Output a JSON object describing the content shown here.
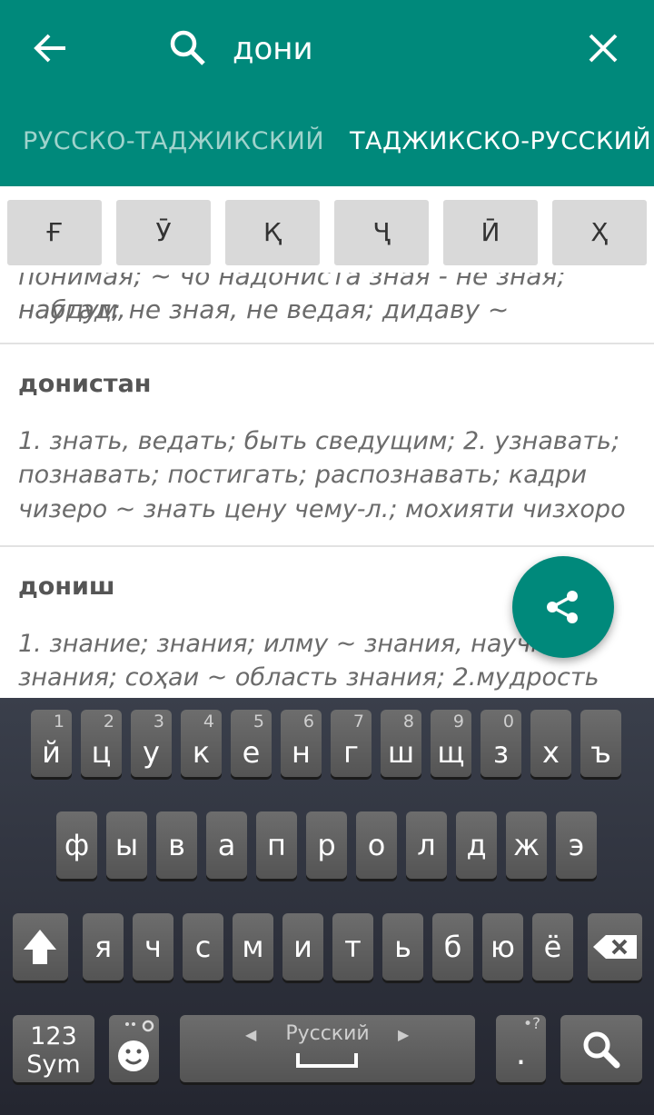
{
  "search": {
    "query": "дони"
  },
  "tabs": [
    {
      "label": "РУССКО-ТАДЖИКСКИЙ"
    },
    {
      "label": "ТАДЖИКСКО-РУССКИЙ"
    }
  ],
  "special_chars": [
    "Ғ",
    "Ӯ",
    "Қ",
    "Ҷ",
    "Ӣ",
    "Ҳ"
  ],
  "entries": {
    "partial_line_1": "понимая; ~ чо надониста зная - не зная; набдум,",
    "partial_line_2": "наугад; не зная, не ведая; дидаву ~",
    "e1_headword": "донистан",
    "e1_def_line_1": "1. знать, ведать; быть сведущим; 2. узнавать;",
    "e1_def_line_2": "познавать; постигать; распознавать; кадри",
    "e1_def_line_3": "чизеро ~ знать цену чему-л.; мохияти чизхоро",
    "e2_headword": "дониш",
    "e2_def_line_1": "1. знание; знания; илму ~ знания, научные",
    "e2_def_line_2": "знания; соҳаи ~ область знания; 2.мудрость"
  },
  "keyboard": {
    "row1": [
      {
        "k": "й",
        "n": "1"
      },
      {
        "k": "ц",
        "n": "2"
      },
      {
        "k": "у",
        "n": "3"
      },
      {
        "k": "к",
        "n": "4"
      },
      {
        "k": "е",
        "n": "5"
      },
      {
        "k": "н",
        "n": "6"
      },
      {
        "k": "г",
        "n": "7"
      },
      {
        "k": "ш",
        "n": "8"
      },
      {
        "k": "щ",
        "n": "9"
      },
      {
        "k": "з",
        "n": "0"
      },
      {
        "k": "х",
        "n": ""
      },
      {
        "k": "ъ",
        "n": ""
      }
    ],
    "row2": [
      "ф",
      "ы",
      "в",
      "а",
      "п",
      "р",
      "о",
      "л",
      "д",
      "ж",
      "э"
    ],
    "row3": [
      "я",
      "ч",
      "с",
      "м",
      "и",
      "т",
      "ь",
      "б",
      "ю",
      "ё"
    ],
    "sym_label_1": "123",
    "sym_label_2": "Sym",
    "space_language": "Русский",
    "period_hint": "•?",
    "period": "."
  },
  "colors": {
    "primary": "#00897b",
    "tab_inactive": "#9fd3cc",
    "key_bg": "#616161"
  }
}
